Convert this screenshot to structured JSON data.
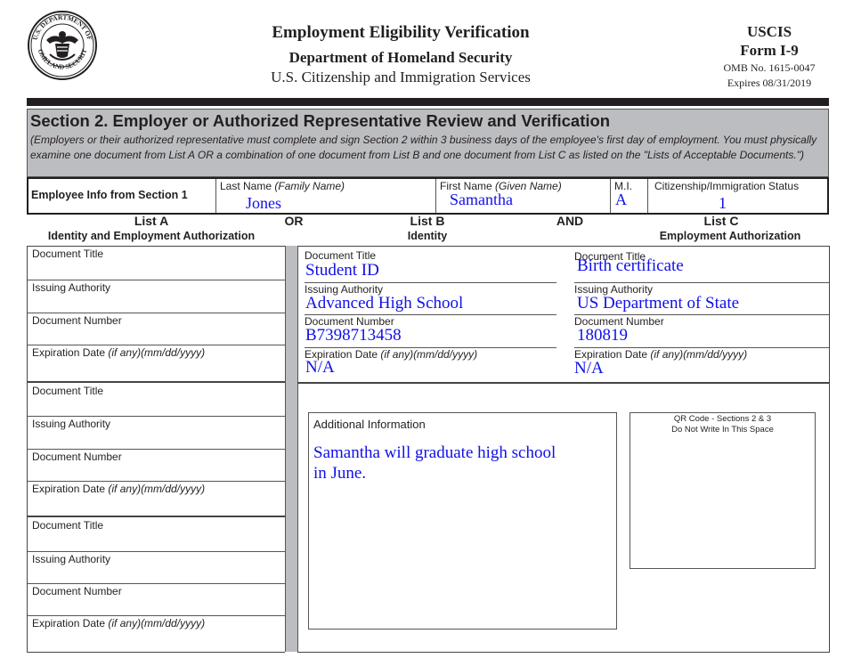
{
  "header": {
    "seal_icon": "dhs-seal-icon",
    "seal_text_top": "U.S. DEPARTMENT OF",
    "seal_text_bottom": "HOMELAND SECURITY",
    "title": "Employment Eligibility Verification",
    "department": "Department of Homeland Security",
    "agency": "U.S. Citizenship and Immigration Services",
    "org": "USCIS",
    "form": "Form I-9",
    "omb": "OMB No. 1615-0047",
    "expires": "Expires 08/31/2019"
  },
  "section2": {
    "title": "Section 2. Employer or Authorized Representative Review and Verification",
    "description": "(Employers or their authorized representative must complete and sign Section 2 within 3 business days of the employee's first day of employment. You must physically examine one document from List A OR a combination of one document from List B and one document from List C as listed on the \"Lists of Acceptable Documents.\")"
  },
  "employee_info": {
    "row_label": "Employee Info from Section 1",
    "last_name_label": "Last Name",
    "last_name_hint": "(Family Name)",
    "last_name": "Jones",
    "first_name_label": "First Name",
    "first_name_hint": "(Given Name)",
    "first_name": "Samantha",
    "mi_label": "M.I.",
    "mi": "A",
    "status_label": "Citizenship/Immigration Status",
    "status": "1"
  },
  "lists": {
    "a_title": "List A",
    "a_subtitle": "Identity and Employment Authorization",
    "or": "OR",
    "b_title": "List B",
    "b_subtitle": "Identity",
    "and": "AND",
    "c_title": "List C",
    "c_subtitle": "Employment Authorization"
  },
  "labels": {
    "doc_title": "Document Title",
    "issuing": "Issuing Authority",
    "doc_number": "Document Number",
    "exp_date": "Expiration Date ",
    "exp_hint": "(if any)(mm/dd/yyyy)"
  },
  "list_a_documents": [
    {
      "title": "",
      "issuing": "",
      "number": "",
      "expiration": ""
    },
    {
      "title": "",
      "issuing": "",
      "number": "",
      "expiration": ""
    },
    {
      "title": "",
      "issuing": "",
      "number": "",
      "expiration": ""
    }
  ],
  "list_b": {
    "title": "Student ID",
    "issuing": "Advanced High School",
    "number": "B7398713458",
    "expiration": "N/A"
  },
  "list_c": {
    "title": "Birth certificate",
    "issuing": "US Department of State",
    "number": "180819",
    "expiration": "N/A"
  },
  "additional_info": {
    "label": "Additional Information",
    "text_line1": "Samantha will graduate high school",
    "text_line2": "in June."
  },
  "qr": {
    "line1": "QR Code - Sections 2 & 3",
    "line2": "Do Not Write In This Space"
  }
}
